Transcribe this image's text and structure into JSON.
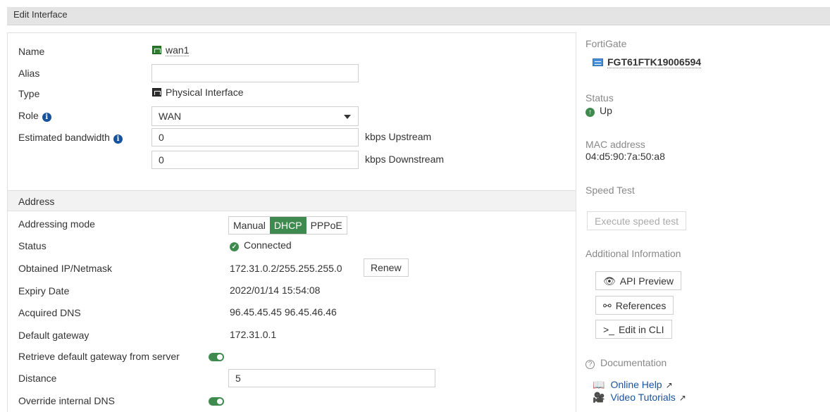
{
  "header": {
    "title": "Edit Interface"
  },
  "form": {
    "name_label": "Name",
    "name_value": "wan1",
    "alias_label": "Alias",
    "alias_value": "",
    "type_label": "Type",
    "type_value": "Physical Interface",
    "role_label": "Role",
    "role_value": "WAN",
    "bandwidth_label": "Estimated bandwidth",
    "upstream_value": "0",
    "upstream_unit": "kbps Upstream",
    "downstream_value": "0",
    "downstream_unit": "kbps Downstream"
  },
  "address": {
    "section_title": "Address",
    "mode_label": "Addressing mode",
    "modes": [
      "Manual",
      "DHCP",
      "PPPoE"
    ],
    "selected_mode": "DHCP",
    "status_label": "Status",
    "status_value": "Connected",
    "ip_label": "Obtained IP/Netmask",
    "ip_value": "172.31.0.2/255.255.255.0",
    "renew_label": "Renew",
    "expiry_label": "Expiry Date",
    "expiry_value": "2022/01/14 15:54:08",
    "dns_label": "Acquired DNS",
    "dns_value": "96.45.45.45 96.45.46.46",
    "gateway_label": "Default gateway",
    "gateway_value": "172.31.0.1",
    "retrieve_label": "Retrieve default gateway from server",
    "retrieve_enabled": true,
    "distance_label": "Distance",
    "distance_value": "5",
    "override_dns_label": "Override internal DNS",
    "override_dns_enabled": true
  },
  "sidebar": {
    "device_heading": "FortiGate",
    "device_name": "FGT61FTK19006594",
    "status_heading": "Status",
    "status_value": "Up",
    "mac_heading": "MAC address",
    "mac_value": "04:d5:90:7a:50:a8",
    "speed_heading": "Speed Test",
    "speed_button": "Execute speed test",
    "additional_heading": "Additional Information",
    "api_preview": "API Preview",
    "references": "References",
    "edit_cli": "Edit in CLI",
    "documentation_heading": "Documentation",
    "online_help": "Online Help",
    "video_tutorials": "Video Tutorials"
  },
  "colors": {
    "accent_green": "#3f8a4e",
    "info_blue": "#17539d",
    "link_blue": "#17539d"
  }
}
